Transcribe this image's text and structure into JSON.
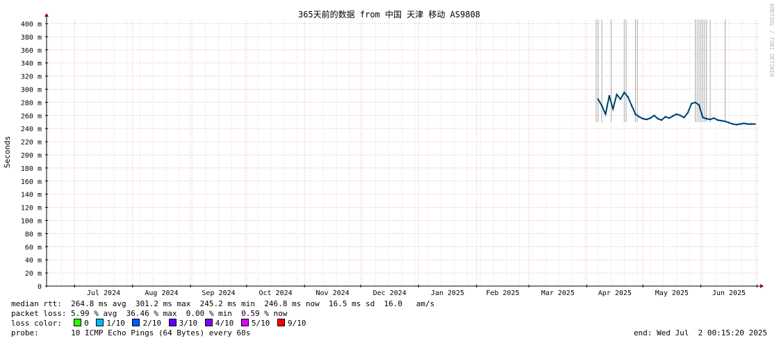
{
  "chart_data": {
    "type": "line",
    "title": "365天前的数据 from 中国 天津 移动 AS9808",
    "ylabel": "Seconds",
    "y_unit": "m",
    "ylim": [
      0,
      400
    ],
    "y_ticks": [
      "0",
      "20 m",
      "40 m",
      "60 m",
      "80 m",
      "100 m",
      "120 m",
      "140 m",
      "160 m",
      "180 m",
      "200 m",
      "220 m",
      "240 m",
      "260 m",
      "280 m",
      "300 m",
      "320 m",
      "340 m",
      "360 m",
      "380 m",
      "400 m"
    ],
    "x_ticks": [
      "Jul 2024",
      "Aug 2024",
      "Sep 2024",
      "Oct 2024",
      "Nov 2024",
      "Dec 2024",
      "Jan 2025",
      "Feb 2025",
      "Mar 2025",
      "Apr 2025",
      "May 2025",
      "Jun 2025"
    ],
    "xlim": [
      "2024-06-16",
      "2025-07-02"
    ],
    "grid": true,
    "watermark": "RRDTOOL / TOBI OETIKER",
    "series": [
      {
        "name": "median rtt",
        "color": "#000000",
        "points": [
          [
            "2025-04-07",
            285
          ],
          [
            "2025-04-09",
            275
          ],
          [
            "2025-04-11",
            262
          ],
          [
            "2025-04-13",
            290
          ],
          [
            "2025-04-15",
            270
          ],
          [
            "2025-04-17",
            292
          ],
          [
            "2025-04-19",
            285
          ],
          [
            "2025-04-21",
            295
          ],
          [
            "2025-04-23",
            288
          ],
          [
            "2025-04-25",
            275
          ],
          [
            "2025-04-27",
            262
          ],
          [
            "2025-04-29",
            258
          ],
          [
            "2025-05-01",
            255
          ],
          [
            "2025-05-03",
            254
          ],
          [
            "2025-05-05",
            256
          ],
          [
            "2025-05-07",
            260
          ],
          [
            "2025-05-09",
            255
          ],
          [
            "2025-05-11",
            253
          ],
          [
            "2025-05-13",
            258
          ],
          [
            "2025-05-15",
            256
          ],
          [
            "2025-05-17",
            259
          ],
          [
            "2025-05-19",
            262
          ],
          [
            "2025-05-21",
            260
          ],
          [
            "2025-05-23",
            257
          ],
          [
            "2025-05-25",
            264
          ],
          [
            "2025-05-27",
            278
          ],
          [
            "2025-05-29",
            280
          ],
          [
            "2025-05-31",
            276
          ],
          [
            "2025-06-02",
            257
          ],
          [
            "2025-06-04",
            255
          ],
          [
            "2025-06-06",
            254
          ],
          [
            "2025-06-08",
            256
          ],
          [
            "2025-06-10",
            253
          ],
          [
            "2025-06-12",
            252
          ],
          [
            "2025-06-14",
            251
          ],
          [
            "2025-06-16",
            249
          ],
          [
            "2025-06-18",
            247
          ],
          [
            "2025-06-20",
            246
          ],
          [
            "2025-06-22",
            247
          ],
          [
            "2025-06-24",
            248
          ],
          [
            "2025-06-26",
            247
          ],
          [
            "2025-06-28",
            247
          ],
          [
            "2025-06-30",
            247
          ]
        ]
      }
    ],
    "loss_spikes": [
      "2025-04-06",
      "2025-04-07",
      "2025-04-09",
      "2025-04-14",
      "2025-04-21",
      "2025-04-22",
      "2025-04-27",
      "2025-04-28",
      "2025-05-29",
      "2025-05-30",
      "2025-05-31",
      "2025-06-01",
      "2025-06-02",
      "2025-06-03",
      "2025-06-04",
      "2025-06-06",
      "2025-06-14"
    ]
  },
  "legend": {
    "median_rtt": {
      "label": "median rtt:",
      "avg": "264.8 ms avg",
      "max": "301.2 ms max",
      "min": "245.2 ms min",
      "now": "246.8 ms now",
      "sd": "16.5 ms sd",
      "am": "16.0",
      "am_unit": "am/s"
    },
    "packet_loss": {
      "label": "packet loss:",
      "avg": "5.99 % avg",
      "max": "36.46 % max",
      "min": "0.00 % min",
      "now": "0.59 % now"
    },
    "loss_color": {
      "label": "loss color:",
      "items": [
        {
          "label": "0",
          "color": "#26ff00"
        },
        {
          "label": "1/10",
          "color": "#00b8ff"
        },
        {
          "label": "2/10",
          "color": "#0059ff"
        },
        {
          "label": "3/10",
          "color": "#5e00ff"
        },
        {
          "label": "4/10",
          "color": "#7e00ff"
        },
        {
          "label": "5/10",
          "color": "#dd00ff"
        },
        {
          "label": "9/10",
          "color": "#ff0000"
        }
      ]
    },
    "probe": {
      "label": "probe:",
      "value": "10 ICMP Echo Pings (64 Bytes) every 60s"
    },
    "end": "end: Wed Jul  2 00:15:20 2025"
  }
}
